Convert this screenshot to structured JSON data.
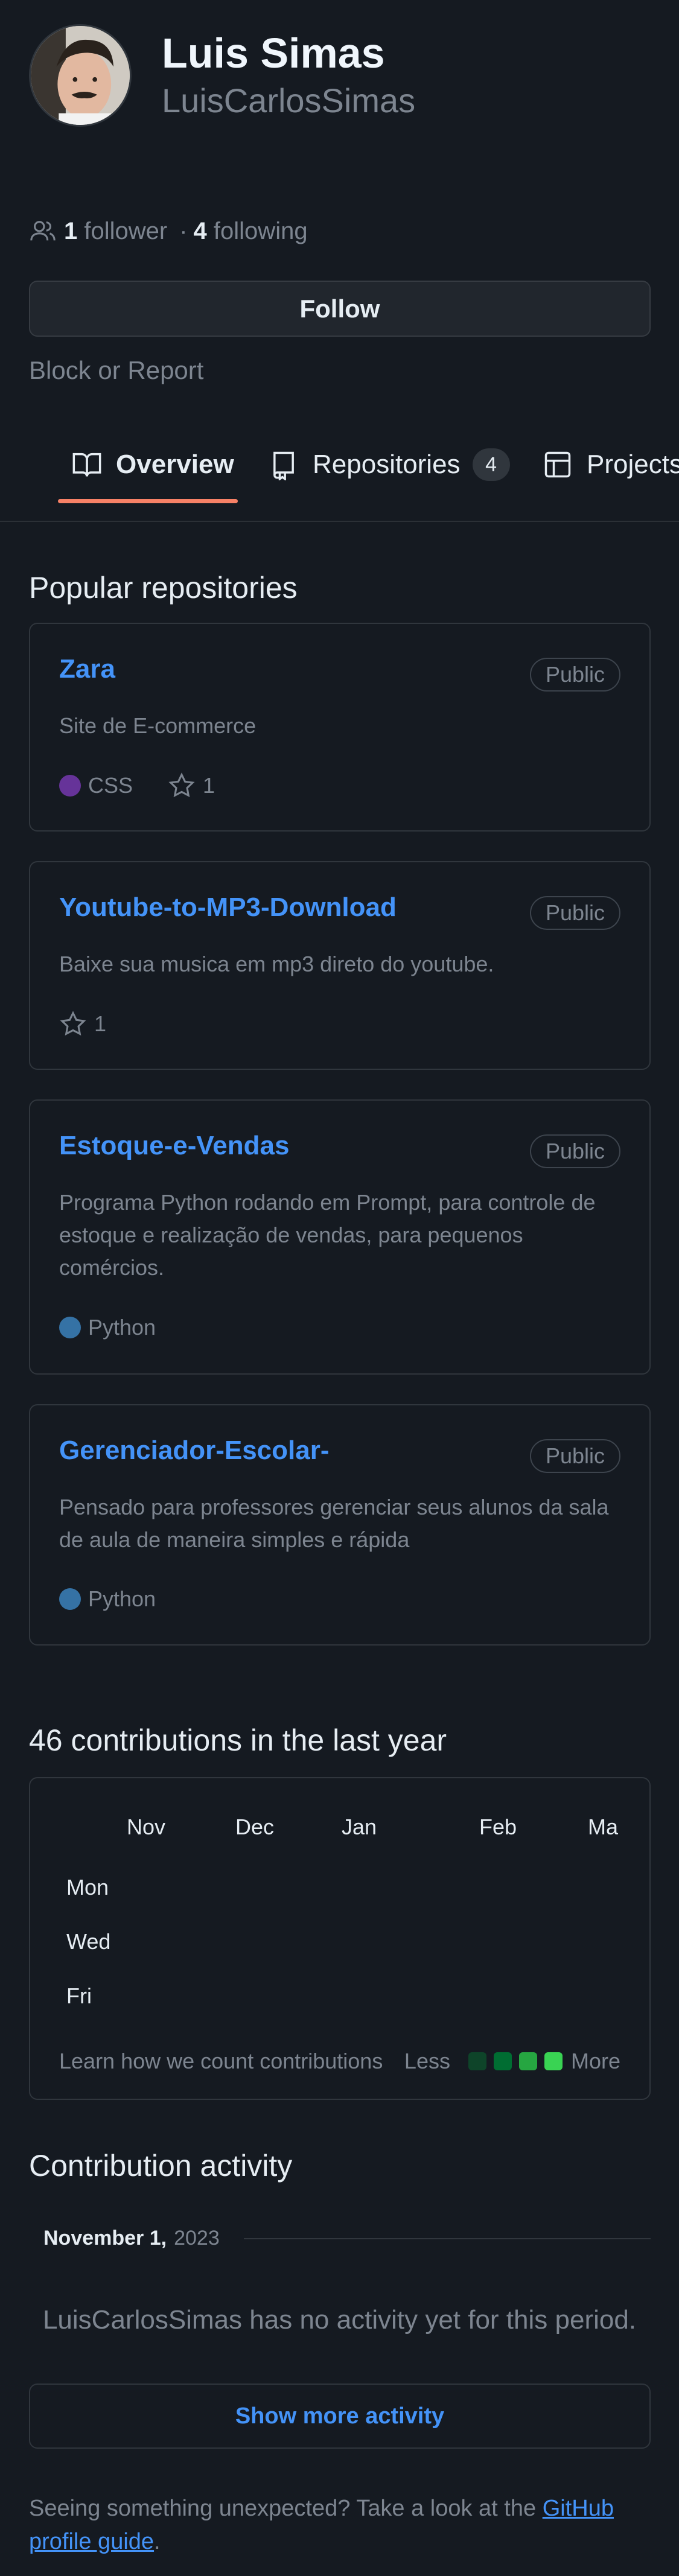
{
  "profile": {
    "full_name": "Luis Simas",
    "login": "LuisCarlosSimas",
    "followers_count": "1",
    "followers_label": "follower",
    "separator": "·",
    "following_count": "4",
    "following_label": "following",
    "follow_button": "Follow",
    "block_report": "Block or Report"
  },
  "tabs": [
    {
      "label": "Overview",
      "icon": "book-icon",
      "active": true
    },
    {
      "label": "Repositories",
      "icon": "repo-icon",
      "counter": "4"
    },
    {
      "label": "Projects",
      "icon": "table-icon"
    }
  ],
  "popular": {
    "title": "Popular repositories",
    "repos": [
      {
        "name": "Zara",
        "visibility": "Public",
        "description": "Site de E-commerce",
        "language": "CSS",
        "language_color": "#663399",
        "stars": "1"
      },
      {
        "name": "Youtube-to-MP3-Download",
        "visibility": "Public",
        "description": "Baixe sua musica em mp3 direto do youtube.",
        "stars": "1"
      },
      {
        "name": "Estoque-e-Vendas",
        "visibility": "Public",
        "description": "Programa Python rodando em Prompt, para controle de estoque e realização de vendas, para pequenos comércios.",
        "language": "Python",
        "language_color": "#3572A5"
      },
      {
        "name": "Gerenciador-Escolar-",
        "visibility": "Public",
        "description": "Pensado para professores gerenciar seus alunos da sala de aula de maneira simples e rápida",
        "language": "Python",
        "language_color": "#3572A5"
      }
    ]
  },
  "contributions": {
    "title": "46 contributions in the last year",
    "months": [
      "Nov",
      "Dec",
      "Jan",
      "Feb",
      "Ma"
    ],
    "days": [
      "Mon",
      "Wed",
      "Fri"
    ],
    "learn_link": "Learn how we count contributions",
    "less": "Less",
    "more": "More",
    "legend_colors": [
      "#0e4429",
      "#006d32",
      "#26a641",
      "#39d353"
    ]
  },
  "activity": {
    "title": "Contribution activity",
    "month_label": "November 1,",
    "year": "2023",
    "empty_message": "LuisCarlosSimas has no activity yet for this period.",
    "show_more": "Show more activity"
  },
  "footer": {
    "text": "Seeing something unexpected? Take a look at the",
    "link": "GitHub profile guide",
    "end": "."
  },
  "colors": {
    "background": "#151a21",
    "accent": "#4493f8",
    "tab_underline": "#f78166"
  }
}
